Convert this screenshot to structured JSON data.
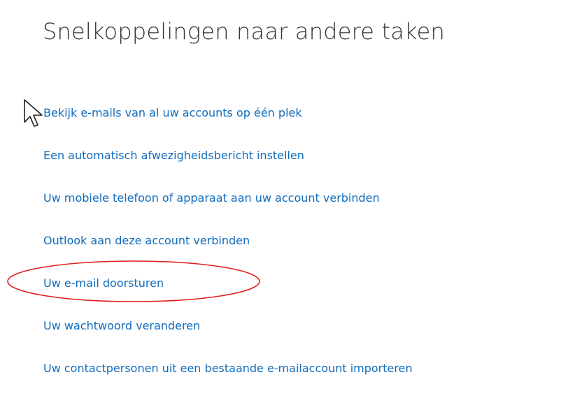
{
  "page": {
    "title": "Snelkoppelingen naar andere taken"
  },
  "links": [
    {
      "label": "Bekijk e-mails van al uw accounts op één plek"
    },
    {
      "label": "Een automatisch afwezigheidsbericht instellen"
    },
    {
      "label": "Uw mobiele telefoon of apparaat aan uw account verbinden"
    },
    {
      "label": "Outlook aan deze account verbinden"
    },
    {
      "label": "Uw e-mail doorsturen"
    },
    {
      "label": "Uw wachtwoord veranderen"
    },
    {
      "label": "Uw contactpersonen uit een bestaande e-mailaccount importeren"
    }
  ],
  "colors": {
    "link": "#0f6cbd",
    "title": "#333333",
    "highlight": "#e01b1b"
  },
  "annotations": {
    "highlighted_link": "Uw e-mail doorsturen",
    "cursor_icon": "mouse-pointer-icon",
    "highlight_shape": "red-ellipse"
  }
}
